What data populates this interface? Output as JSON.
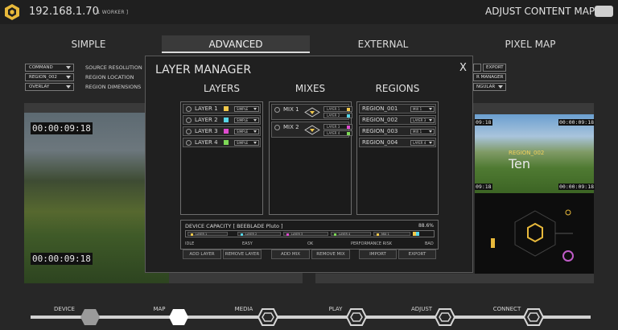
{
  "header": {
    "ip": "192.168.1.70",
    "worker": "[ 1 WORKER ]",
    "adjust_content_map": "ADJUST CONTENT MAP"
  },
  "tabs": [
    {
      "label": "SIMPLE",
      "active": false
    },
    {
      "label": "ADVANCED",
      "active": true
    },
    {
      "label": "EXTERNAL",
      "active": false
    },
    {
      "label": "PIXEL MAP",
      "active": false
    }
  ],
  "properties": {
    "selects": [
      "COMMAND",
      "REGION_002",
      "OVERLAY"
    ],
    "labels": [
      "SOURCE RESOLUTION",
      "REGION LOCATION",
      "REGION DIMENSIONS"
    ]
  },
  "right_panel": {
    "buttons": [
      "EXPORT"
    ],
    "partial_texts": [
      "R MANAGER",
      "NGULAR"
    ]
  },
  "previews": {
    "left_timecode_top": "00:00:09:18",
    "left_timecode_bottom": "00:00:09:18",
    "right_tc_top_left": "09:18",
    "right_tc_top_right": "00:00:09:18",
    "right_tc_mid_left": "09:18",
    "right_tc_mid_right": "00:00:09:18",
    "region_label": "REGION_002",
    "region_text": "Ten"
  },
  "modal": {
    "title": "LAYER MANAGER",
    "close": "X",
    "layers": {
      "heading": "LAYERS",
      "items": [
        {
          "label": "LAYER 1",
          "color": "#f2c94c",
          "mode": "SIMPLE"
        },
        {
          "label": "LAYER 2",
          "color": "#56d6e8",
          "mode": "SIMPLE"
        },
        {
          "label": "LAYER 3",
          "color": "#e04bd0",
          "mode": "SIMPLE"
        },
        {
          "label": "LAYER 4",
          "color": "#7ed957",
          "mode": "SIMPLE"
        }
      ],
      "add": "ADD LAYER",
      "remove": "REMOVE LAYER"
    },
    "mixes": {
      "heading": "MIXES",
      "items": [
        {
          "label": "MIX 1",
          "a": "LAYER 1",
          "a_color": "#f2c94c",
          "b": "LAYER 2",
          "b_color": "#56d6e8"
        },
        {
          "label": "MIX 2",
          "a": "LAYER 3",
          "a_color": "#e04bd0",
          "b": "LAYER 4",
          "b_color": "#7ed957"
        }
      ],
      "add": "ADD MIX",
      "remove": "REMOVE MIX"
    },
    "regions": {
      "heading": "REGIONS",
      "items": [
        {
          "label": "REGION_001",
          "source": "MIX 1"
        },
        {
          "label": "REGION_002",
          "source": "LAYER 3"
        },
        {
          "label": "REGION_003",
          "source": "MIX 1"
        },
        {
          "label": "REGION_004",
          "source": "LAYER 4"
        }
      ],
      "import": "IMPORT",
      "export": "EXPORT"
    },
    "capacity": {
      "title": "DEVICE CAPACITY [ BEEBLADE Pluto ]",
      "percent": "88.6%",
      "segments": [
        {
          "label": "LAYER 1",
          "color": "#f2c94c"
        },
        {
          "label": "LAYER 2",
          "color": "#56d6e8"
        },
        {
          "label": "LAYER 3",
          "color": "#e04bd0"
        },
        {
          "label": "LAYER 4",
          "color": "#7ed957"
        },
        {
          "label": "MIX 1",
          "color": "#f2c94c"
        }
      ],
      "scale": [
        "IDLE",
        "EASY",
        "OK",
        "PERFORMANCE RISK",
        "BAD"
      ]
    }
  },
  "stepper": {
    "steps": [
      {
        "label": "DEVICE",
        "state": "done"
      },
      {
        "label": "MAP",
        "state": "current"
      },
      {
        "label": "MEDIA",
        "state": "todo"
      },
      {
        "label": "PLAY",
        "state": "todo"
      },
      {
        "label": "ADJUST",
        "state": "todo"
      },
      {
        "label": "CONNECT",
        "state": "todo"
      }
    ]
  }
}
